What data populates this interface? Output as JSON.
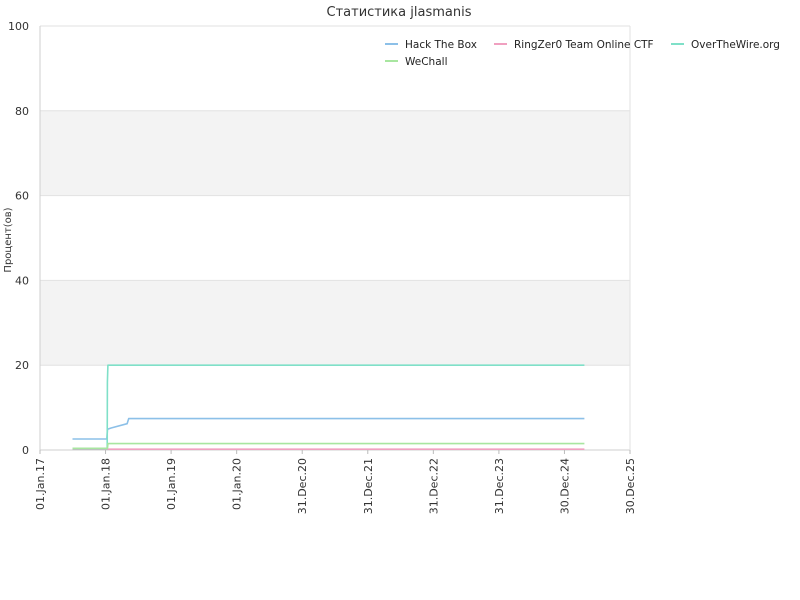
{
  "chart_data": {
    "type": "line",
    "title": "Статистика jlasmanis",
    "ylabel": "Процент(ов)",
    "xlabel": "",
    "ylim": [
      0,
      100
    ],
    "yticks": [
      0,
      20,
      40,
      60,
      80,
      100
    ],
    "xticks": [
      "01.Jan.17",
      "01.Jan.18",
      "01.Jan.19",
      "01.Jan.20",
      "31.Dec.20",
      "31.Dec.21",
      "31.Dec.22",
      "31.Dec.23",
      "30.Dec.24",
      "30.Dec.25"
    ],
    "xlim": [
      "2017-01-01",
      "2025-12-30"
    ],
    "grid": "horizontal alternating bands",
    "legend_position": "top-right",
    "series": [
      {
        "name": "Hack The Box",
        "color": "#8cc0e8",
        "points": [
          [
            "2017-07-01",
            2.6
          ],
          [
            "2018-01-08",
            2.6
          ],
          [
            "2018-01-12",
            4.9
          ],
          [
            "2018-02-01",
            5.2
          ],
          [
            "2018-05-01",
            6.2
          ],
          [
            "2018-05-10",
            7.4
          ],
          [
            "2025-04-20",
            7.4
          ]
        ]
      },
      {
        "name": "RingZer0 Team Online CTF",
        "color": "#f0a0c0",
        "points": [
          [
            "2017-07-01",
            0.2
          ],
          [
            "2025-04-20",
            0.2
          ]
        ]
      },
      {
        "name": "OverTheWire.org",
        "color": "#7fe0c8",
        "points": [
          [
            "2017-07-01",
            0.3
          ],
          [
            "2018-01-10",
            0.3
          ],
          [
            "2018-01-11",
            16.0
          ],
          [
            "2018-01-14",
            20.0
          ],
          [
            "2025-04-20",
            20.0
          ]
        ]
      },
      {
        "name": "WeChall",
        "color": "#a8e6a0",
        "points": [
          [
            "2017-07-01",
            0.4
          ],
          [
            "2018-01-12",
            0.4
          ],
          [
            "2018-01-14",
            1.5
          ],
          [
            "2025-04-20",
            1.5
          ]
        ]
      }
    ]
  }
}
